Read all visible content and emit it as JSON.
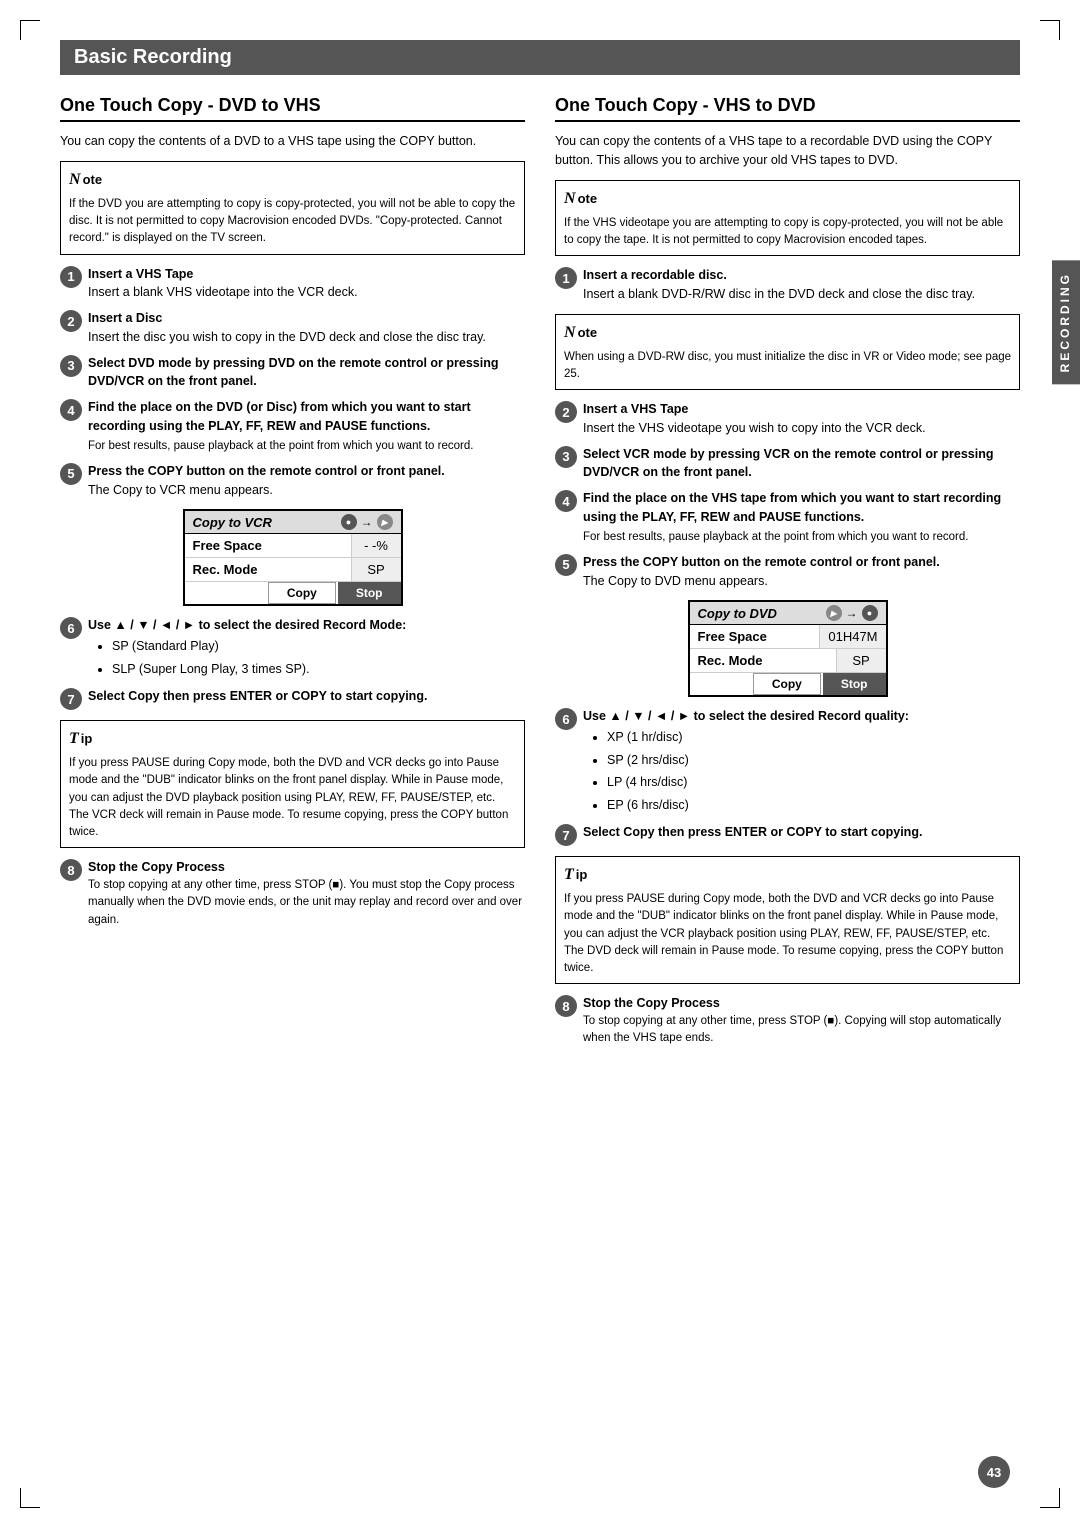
{
  "page": {
    "title": "Basic Recording",
    "page_number": "43",
    "recording_tab": "RECORDING"
  },
  "left_section": {
    "heading": "One Touch Copy - DVD to VHS",
    "intro": "You can copy the contents of a DVD to a VHS tape using the COPY button.",
    "note1": {
      "text": "If the DVD you are attempting to copy is copy-protected, you will not be able to copy the disc. It is not permitted to copy Macrovision encoded DVDs. \"Copy-protected. Cannot record.\" is displayed on the TV screen."
    },
    "steps": [
      {
        "num": "1",
        "title": "Insert a VHS Tape",
        "detail": "Insert a blank VHS videotape into the VCR deck."
      },
      {
        "num": "2",
        "title": "Insert a Disc",
        "detail": "Insert the disc you wish to copy in the DVD deck and close the disc tray."
      },
      {
        "num": "3",
        "title": "Select DVD mode by pressing DVD on the remote control or pressing DVD/VCR on the front panel.",
        "detail": ""
      },
      {
        "num": "4",
        "title": "Find the place on the DVD (or Disc) from which you want to start recording using the PLAY, FF, REW and PAUSE functions.",
        "detail": "For best results, pause playback at the point from which you want to record."
      },
      {
        "num": "5",
        "title": "Press the COPY button on the remote control or front panel.",
        "detail": "The Copy to VCR menu appears."
      }
    ],
    "menu_vcr": {
      "title": "Copy to VCR",
      "free_space_label": "Free Space",
      "free_space_value": "- -%",
      "rec_mode_label": "Rec. Mode",
      "rec_mode_value": "SP",
      "copy_btn": "Copy",
      "stop_btn": "Stop"
    },
    "step6": {
      "num": "6",
      "title": "Use ▲ / ▼ / ◄ / ► to select the desired Record Mode:",
      "bullets": [
        "SP (Standard Play)",
        "SLP (Super Long Play, 3 times SP)."
      ]
    },
    "step7": {
      "num": "7",
      "title": "Select Copy then press ENTER or COPY to start copying.",
      "detail": ""
    },
    "tip": {
      "text": "If you press PAUSE during Copy mode, both the DVD and VCR decks go into Pause mode and the \"DUB\" indicator blinks on the front panel display. While in Pause mode, you can adjust the DVD playback position using PLAY, REW, FF, PAUSE/STEP, etc. The VCR deck will remain in Pause mode. To resume copying, press the COPY button twice."
    },
    "step8": {
      "num": "8",
      "title": "Stop the Copy Process",
      "detail": "To stop copying at any other time, press STOP (■). You must stop the Copy process manually when the DVD movie ends, or the unit may replay and record over and over again."
    }
  },
  "right_section": {
    "heading": "One Touch Copy - VHS to DVD",
    "intro": "You can copy the contents of a VHS tape to a recordable DVD using the COPY button. This allows you to archive your old VHS tapes to DVD.",
    "note1": {
      "text": "If the VHS videotape you are attempting to copy is copy-protected, you will not be able to copy the tape. It is not permitted to copy Macrovision encoded tapes."
    },
    "steps": [
      {
        "num": "1",
        "title": "Insert a recordable disc.",
        "detail": "Insert a blank DVD-R/RW disc in the DVD deck and close the disc tray."
      }
    ],
    "note2": {
      "text": "When using a DVD-RW disc, you must initialize the disc in VR or Video mode; see page 25."
    },
    "steps2": [
      {
        "num": "2",
        "title": "Insert a VHS Tape",
        "detail": "Insert the VHS videotape you wish to copy into the VCR deck."
      },
      {
        "num": "3",
        "title": "Select VCR mode by pressing VCR on the remote control or pressing DVD/VCR on the front panel.",
        "detail": ""
      },
      {
        "num": "4",
        "title": "Find the place on the VHS tape from which you want to start recording using the PLAY, FF, REW and PAUSE functions.",
        "detail": "For best results, pause playback at the point from which you want to record."
      },
      {
        "num": "5",
        "title": "Press the COPY button on the remote control or front panel.",
        "detail": "The Copy to DVD menu appears."
      }
    ],
    "menu_dvd": {
      "title": "Copy to DVD",
      "free_space_label": "Free Space",
      "free_space_value": "01H47M",
      "rec_mode_label": "Rec. Mode",
      "rec_mode_value": "SP",
      "copy_btn": "Copy",
      "stop_btn": "Stop"
    },
    "step6": {
      "num": "6",
      "title": "Use ▲ / ▼ / ◄ / ► to select the desired Record quality:",
      "bullets": [
        "XP (1 hr/disc)",
        "SP (2 hrs/disc)",
        "LP (4 hrs/disc)",
        "EP (6 hrs/disc)"
      ]
    },
    "step7": {
      "num": "7",
      "title": "Select Copy then press ENTER or COPY to start copying.",
      "detail": ""
    },
    "tip": {
      "text": "If you press PAUSE during Copy mode, both the DVD and VCR decks go into Pause mode and the \"DUB\" indicator blinks on the front panel display. While in Pause mode, you can adjust the VCR playback position using PLAY, REW, FF, PAUSE/STEP, etc. The DVD deck will remain in Pause mode. To resume copying, press the COPY button twice."
    },
    "step8": {
      "num": "8",
      "title": "Stop the Copy Process",
      "detail": "To stop copying at any other time, press STOP (■). Copying will stop automatically when the VHS tape ends."
    }
  }
}
